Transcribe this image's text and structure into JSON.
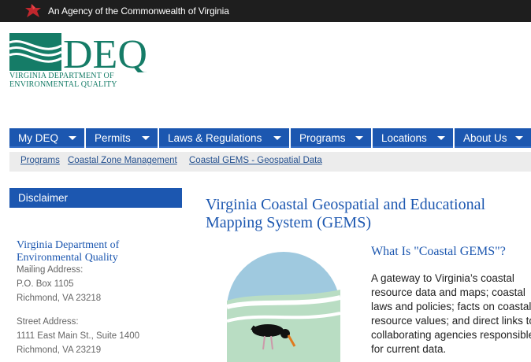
{
  "topbar": {
    "agency_text": "An Agency of the Commonwealth of Virginia",
    "icon": "cardinal-icon"
  },
  "logo": {
    "abbr": "DEQ",
    "line1": "Virginia Department of",
    "line2": "Environmental Quality",
    "color": "#157c67"
  },
  "nav": {
    "color": "#1c57b0",
    "items": [
      {
        "label": "My DEQ"
      },
      {
        "label": "Permits"
      },
      {
        "label": "Laws & Regulations"
      },
      {
        "label": "Programs"
      },
      {
        "label": "Locations"
      },
      {
        "label": "About Us"
      }
    ]
  },
  "breadcrumbs": [
    "Programs",
    "Coastal Zone Management",
    "Coastal GEMS - Geospatial Data"
  ],
  "sidebar": {
    "heading": "Disclaimer",
    "org_name_line1": "Virginia Department of",
    "org_name_line2": "Environmental Quality",
    "mailing_label": "Mailing Address:",
    "mailing_line1": "P.O. Box 1105",
    "mailing_line2": "Richmond, VA 23218",
    "street_label": "Street Address:",
    "street_line1": "1111 East Main St., Suite 1400",
    "street_line2": "Richmond, VA 23219"
  },
  "main": {
    "title": "Virginia Coastal Geospatial and Educational Mapping System (GEMS)",
    "subheading": "What Is \"Coastal GEMS\"?",
    "paragraph": "A gateway to Virginia’s coastal resource data and maps; coastal laws and policies; facts on coastal resource values; and direct links to collaborating agencies responsible for current data."
  }
}
